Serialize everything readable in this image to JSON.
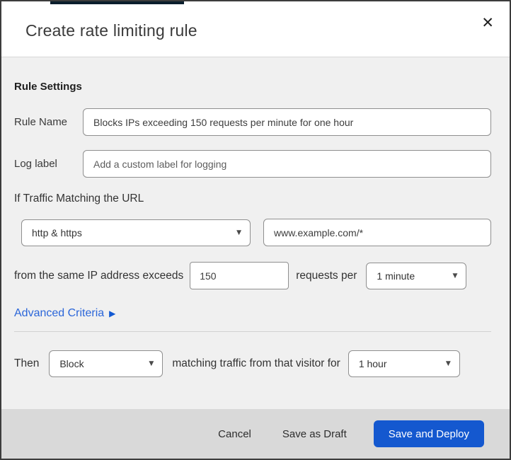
{
  "modal": {
    "title": "Create rate limiting rule"
  },
  "icons": {
    "close": "✕",
    "caret_down": "▼",
    "arrow_right": "▶"
  },
  "colors": {
    "accent_blue": "#2b66d9",
    "primary_button_blue": "#1458cf",
    "content_bg": "#f0f0f0",
    "footer_bg": "#d9d9d9",
    "top_bar_navy": "#0b1e2d"
  },
  "rule_settings": {
    "heading": "Rule Settings",
    "rule_name": {
      "label": "Rule Name",
      "value": "Blocks IPs exceeding 150 requests per minute for one hour"
    },
    "log_label": {
      "label": "Log label",
      "placeholder": "Add a custom label for logging"
    }
  },
  "match": {
    "intro": "If Traffic Matching the URL",
    "scheme_select": {
      "value": "http & https"
    },
    "url_input": {
      "value": "www.example.com/*"
    },
    "threshold_text_before": "from the same IP address exceeds",
    "threshold_input": {
      "value": "150"
    },
    "threshold_text_after": "requests per",
    "period_select": {
      "value": "1 minute"
    },
    "advanced_link": "Advanced Criteria"
  },
  "action": {
    "then_label": "Then",
    "action_select": {
      "value": "Block"
    },
    "middle_text": "matching traffic from that visitor for",
    "duration_select": {
      "value": "1 hour"
    }
  },
  "footer": {
    "cancel": "Cancel",
    "save_draft": "Save as Draft",
    "save_deploy": "Save and Deploy"
  }
}
